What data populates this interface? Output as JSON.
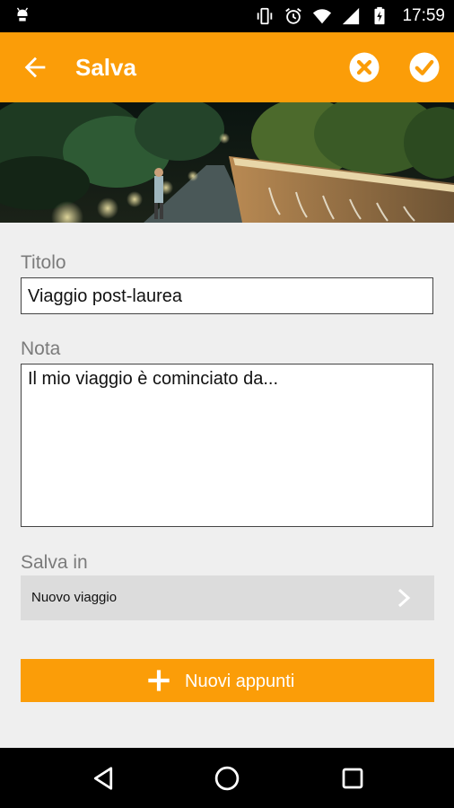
{
  "status_bar": {
    "time": "17:59",
    "icons": [
      "android-icon",
      "vibrate-icon",
      "alarm-icon",
      "wifi-icon",
      "signal-icon",
      "battery-charging-icon"
    ]
  },
  "app_bar": {
    "title": "Salva",
    "back_icon": "arrow-back-icon",
    "cancel_icon": "close-circle-icon",
    "confirm_icon": "check-circle-icon",
    "background": "#fb9d08"
  },
  "form": {
    "title_label": "Titolo",
    "title_value": "Viaggio post-laurea",
    "note_label": "Nota",
    "note_value": "Il mio viaggio è cominciato da...",
    "save_in_label": "Salva in",
    "save_in_value": "Nuovo viaggio",
    "new_notes_button": "Nuovi appunti"
  },
  "nav_bar": {
    "icons": [
      "back-triangle-icon",
      "home-circle-icon",
      "recents-square-icon"
    ]
  }
}
